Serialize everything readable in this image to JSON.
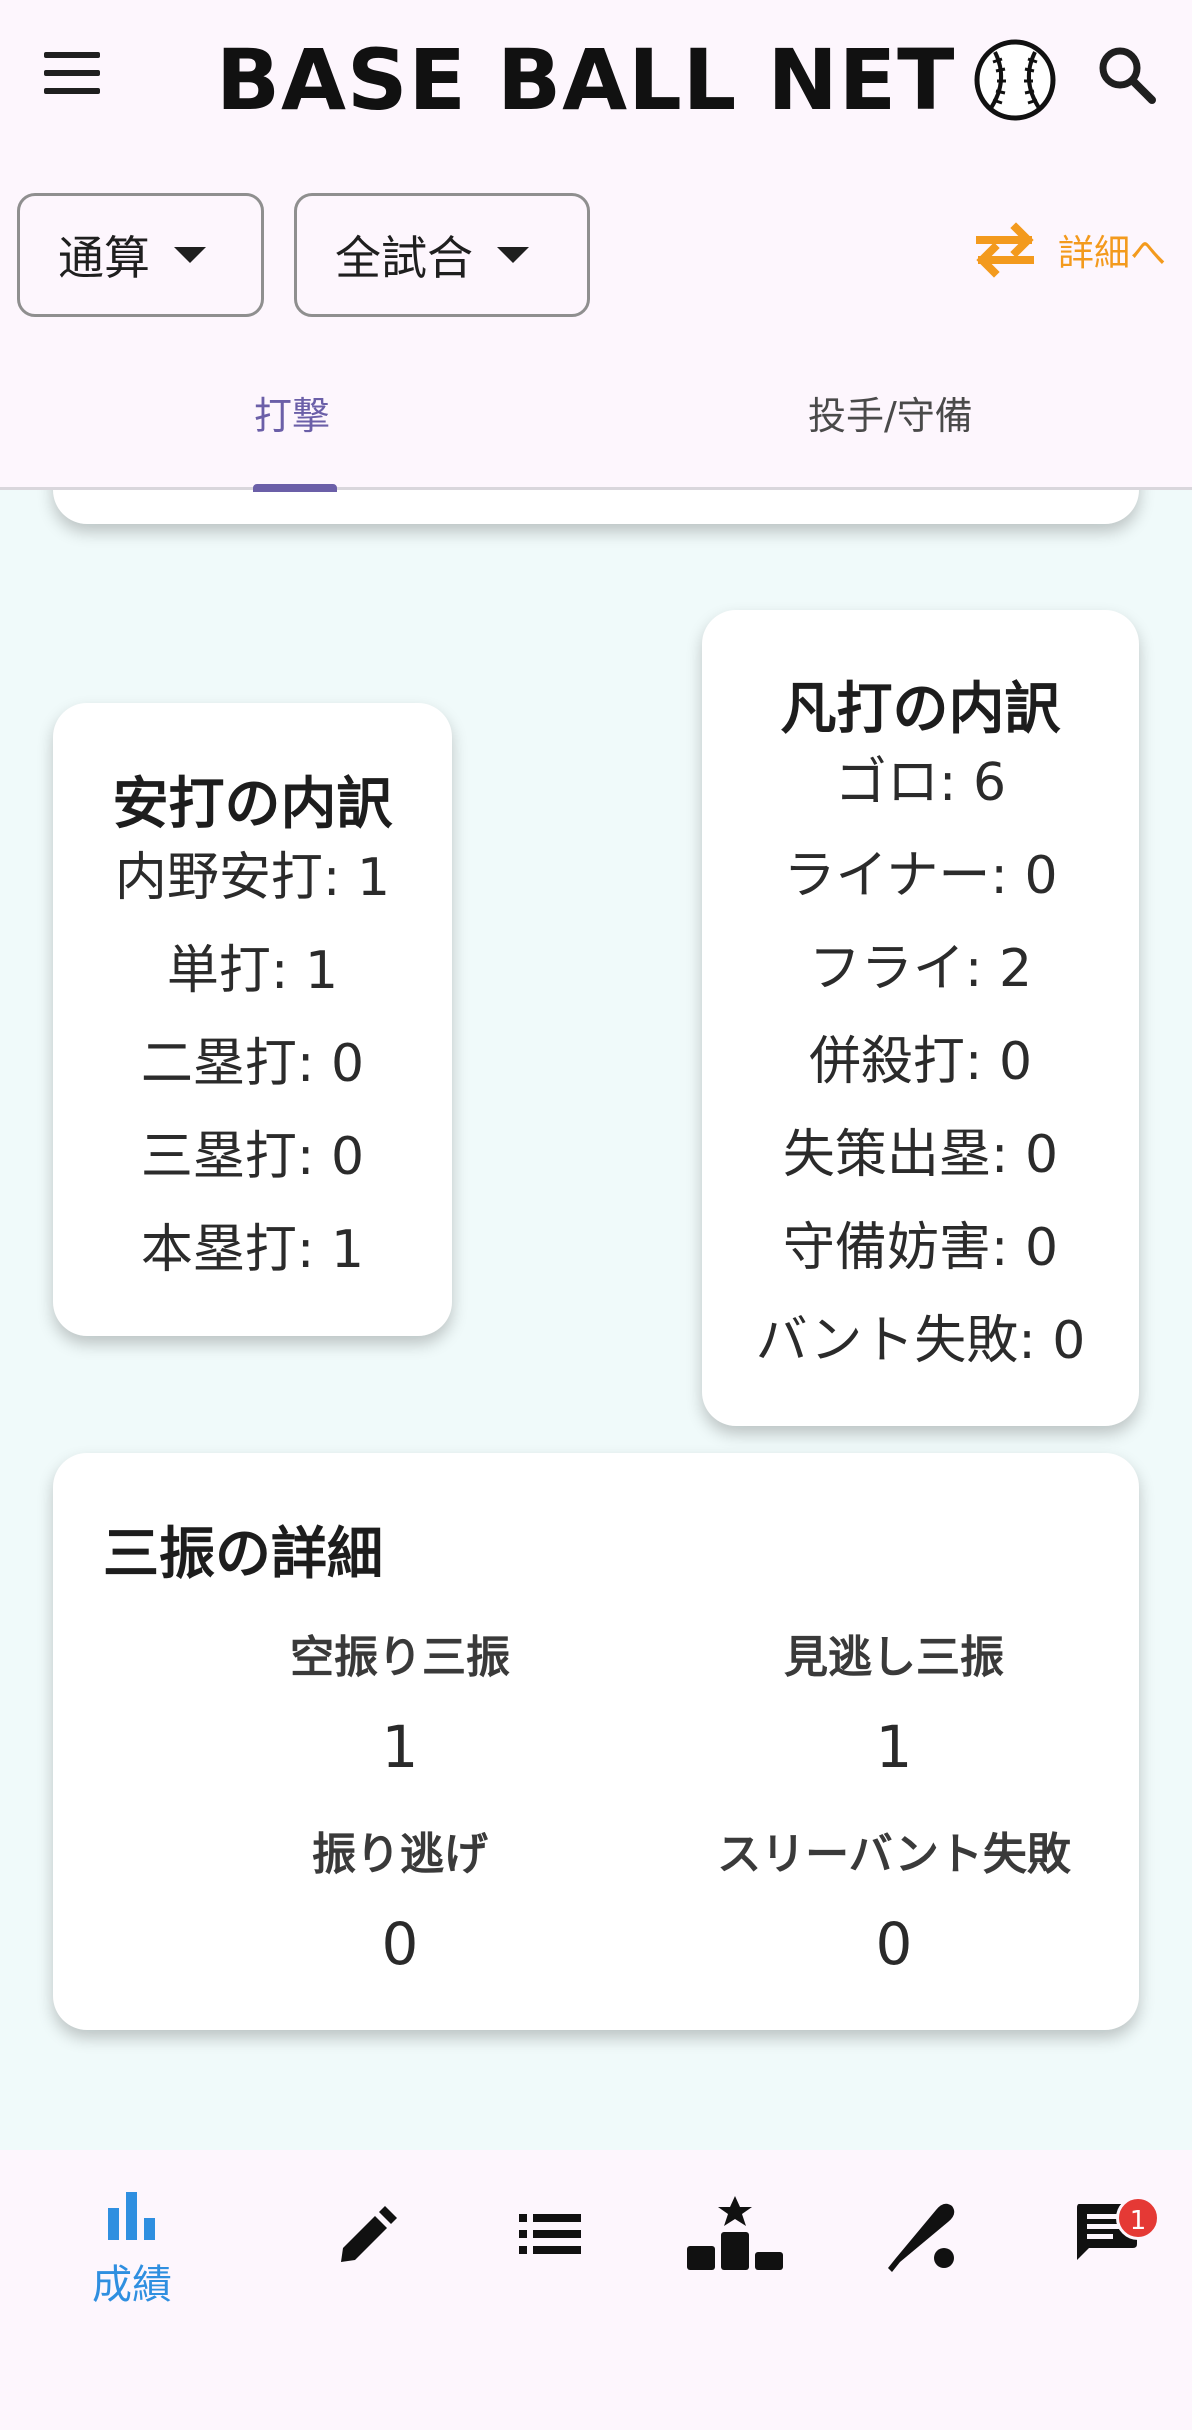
{
  "header": {
    "brand": "BASE BALL NET",
    "filters": {
      "period": "通算",
      "games": "全試合"
    },
    "detail_link": "詳細へ",
    "tabs": [
      {
        "label": "打撃",
        "active": true
      },
      {
        "label": "投手/守備",
        "active": false
      }
    ]
  },
  "hits_breakdown": {
    "title": "安打の内訳",
    "items": [
      {
        "label": "内野安打",
        "value": "1"
      },
      {
        "label": "単打",
        "value": "1"
      },
      {
        "label": "二塁打",
        "value": "0"
      },
      {
        "label": "三塁打",
        "value": "0"
      },
      {
        "label": "本塁打",
        "value": "1"
      }
    ]
  },
  "outs_breakdown": {
    "title": "凡打の内訳",
    "items": [
      {
        "label": "ゴロ",
        "value": "6"
      },
      {
        "label": "ライナー",
        "value": "0"
      },
      {
        "label": "フライ",
        "value": "2"
      },
      {
        "label": "併殺打",
        "value": "0"
      },
      {
        "label": "失策出塁",
        "value": "0"
      },
      {
        "label": "守備妨害",
        "value": "0"
      },
      {
        "label": "バント失敗",
        "value": "0"
      }
    ]
  },
  "strikeouts": {
    "title": "三振の詳細",
    "items": [
      {
        "label": "空振り三振",
        "value": "1"
      },
      {
        "label": "見逃し三振",
        "value": "1"
      },
      {
        "label": "振り逃げ",
        "value": "0"
      },
      {
        "label": "スリーバント失敗",
        "value": "0"
      }
    ]
  },
  "bottom_nav": {
    "items": [
      {
        "icon": "bar-chart-icon",
        "label": "成績",
        "active": true
      },
      {
        "icon": "pencil-icon"
      },
      {
        "icon": "list-icon"
      },
      {
        "icon": "podium-icon"
      },
      {
        "icon": "bat-icon"
      },
      {
        "icon": "chat-icon",
        "badge": "1"
      }
    ]
  },
  "colors": {
    "accent_orange": "#f39a1d",
    "tab_active": "#6b5fa8",
    "nav_active": "#2f8fe0",
    "badge": "#e53935",
    "content_bg": "#f0fafa",
    "bar_bg": "#fdf6fd"
  }
}
